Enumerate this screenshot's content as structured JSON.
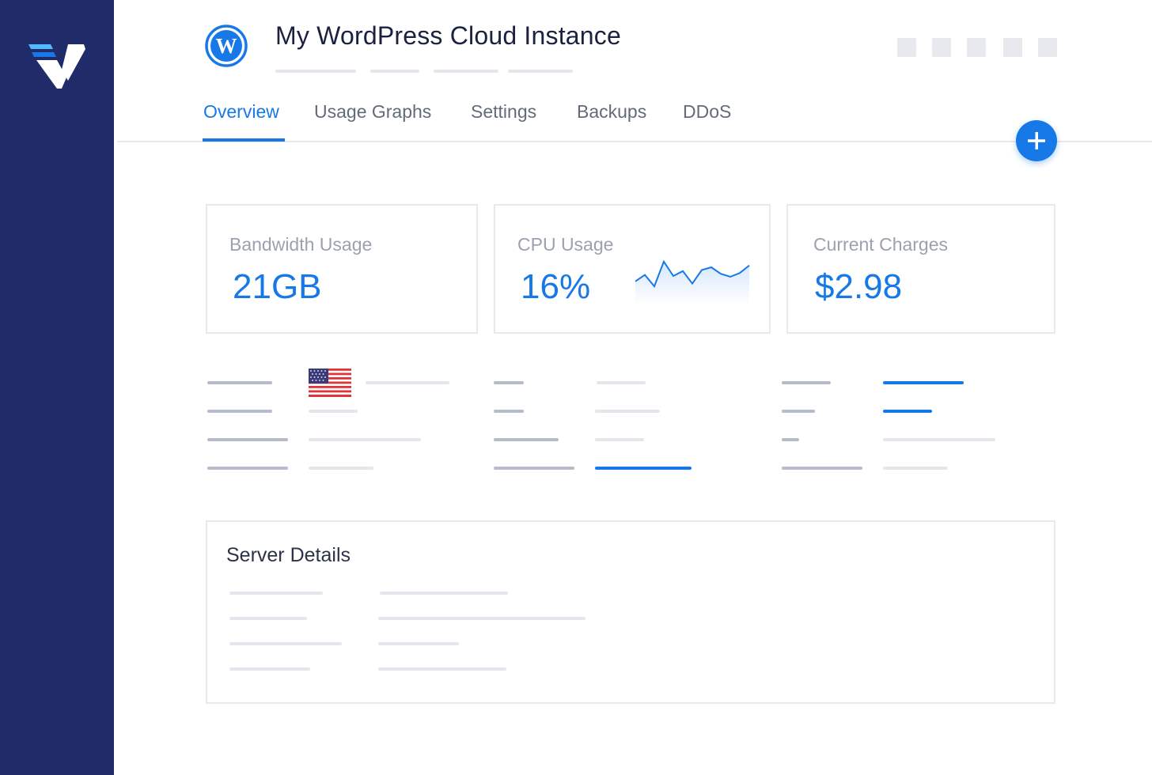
{
  "app": {
    "title": "My WordPress Cloud Instance",
    "brand_color": "#1f2c69",
    "accent_color": "#1778e8"
  },
  "tabs": [
    {
      "label": "Overview",
      "active": true
    },
    {
      "label": "Usage Graphs",
      "active": false
    },
    {
      "label": "Settings",
      "active": false
    },
    {
      "label": "Backups",
      "active": false
    },
    {
      "label": "DDoS",
      "active": false
    }
  ],
  "fab": {
    "icon": "plus-icon"
  },
  "toolbar": {
    "icons": [
      "placeholder-button-1",
      "placeholder-button-2",
      "placeholder-button-3",
      "placeholder-button-4",
      "placeholder-button-5"
    ]
  },
  "stats": {
    "bandwidth": {
      "label": "Bandwidth Usage",
      "value": "21GB"
    },
    "cpu": {
      "label": "CPU Usage",
      "value": "16%",
      "sparkline": [
        0.62,
        0.45,
        0.75,
        0.1,
        0.48,
        0.35,
        0.68,
        0.32,
        0.25,
        0.42,
        0.5,
        0.4,
        0.2
      ]
    },
    "charges": {
      "label": "Current Charges",
      "value": "$2.98"
    }
  },
  "location": {
    "flag_icon": "us-flag-icon"
  },
  "server_details": {
    "title": "Server Details"
  }
}
